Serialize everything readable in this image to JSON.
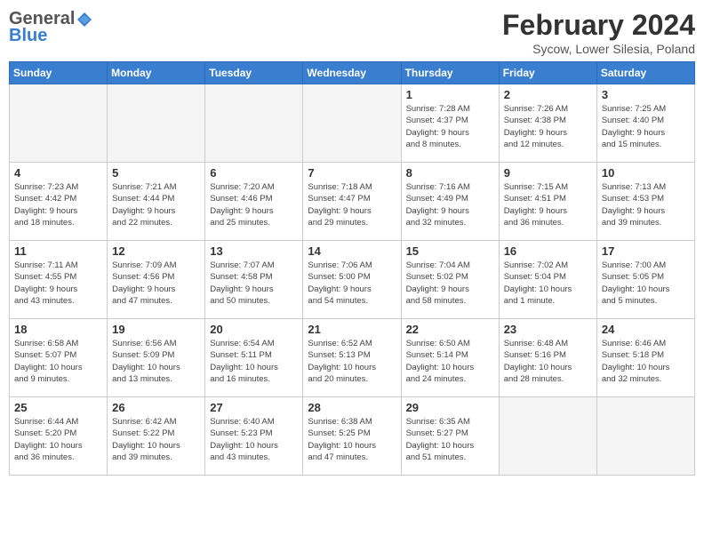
{
  "logo": {
    "general": "General",
    "blue": "Blue"
  },
  "header": {
    "title": "February 2024",
    "subtitle": "Sycow, Lower Silesia, Poland"
  },
  "weekdays": [
    "Sunday",
    "Monday",
    "Tuesday",
    "Wednesday",
    "Thursday",
    "Friday",
    "Saturday"
  ],
  "weeks": [
    [
      {
        "day": "",
        "detail": ""
      },
      {
        "day": "",
        "detail": ""
      },
      {
        "day": "",
        "detail": ""
      },
      {
        "day": "",
        "detail": ""
      },
      {
        "day": "1",
        "detail": "Sunrise: 7:28 AM\nSunset: 4:37 PM\nDaylight: 9 hours\nand 8 minutes."
      },
      {
        "day": "2",
        "detail": "Sunrise: 7:26 AM\nSunset: 4:38 PM\nDaylight: 9 hours\nand 12 minutes."
      },
      {
        "day": "3",
        "detail": "Sunrise: 7:25 AM\nSunset: 4:40 PM\nDaylight: 9 hours\nand 15 minutes."
      }
    ],
    [
      {
        "day": "4",
        "detail": "Sunrise: 7:23 AM\nSunset: 4:42 PM\nDaylight: 9 hours\nand 18 minutes."
      },
      {
        "day": "5",
        "detail": "Sunrise: 7:21 AM\nSunset: 4:44 PM\nDaylight: 9 hours\nand 22 minutes."
      },
      {
        "day": "6",
        "detail": "Sunrise: 7:20 AM\nSunset: 4:46 PM\nDaylight: 9 hours\nand 25 minutes."
      },
      {
        "day": "7",
        "detail": "Sunrise: 7:18 AM\nSunset: 4:47 PM\nDaylight: 9 hours\nand 29 minutes."
      },
      {
        "day": "8",
        "detail": "Sunrise: 7:16 AM\nSunset: 4:49 PM\nDaylight: 9 hours\nand 32 minutes."
      },
      {
        "day": "9",
        "detail": "Sunrise: 7:15 AM\nSunset: 4:51 PM\nDaylight: 9 hours\nand 36 minutes."
      },
      {
        "day": "10",
        "detail": "Sunrise: 7:13 AM\nSunset: 4:53 PM\nDaylight: 9 hours\nand 39 minutes."
      }
    ],
    [
      {
        "day": "11",
        "detail": "Sunrise: 7:11 AM\nSunset: 4:55 PM\nDaylight: 9 hours\nand 43 minutes."
      },
      {
        "day": "12",
        "detail": "Sunrise: 7:09 AM\nSunset: 4:56 PM\nDaylight: 9 hours\nand 47 minutes."
      },
      {
        "day": "13",
        "detail": "Sunrise: 7:07 AM\nSunset: 4:58 PM\nDaylight: 9 hours\nand 50 minutes."
      },
      {
        "day": "14",
        "detail": "Sunrise: 7:06 AM\nSunset: 5:00 PM\nDaylight: 9 hours\nand 54 minutes."
      },
      {
        "day": "15",
        "detail": "Sunrise: 7:04 AM\nSunset: 5:02 PM\nDaylight: 9 hours\nand 58 minutes."
      },
      {
        "day": "16",
        "detail": "Sunrise: 7:02 AM\nSunset: 5:04 PM\nDaylight: 10 hours\nand 1 minute."
      },
      {
        "day": "17",
        "detail": "Sunrise: 7:00 AM\nSunset: 5:05 PM\nDaylight: 10 hours\nand 5 minutes."
      }
    ],
    [
      {
        "day": "18",
        "detail": "Sunrise: 6:58 AM\nSunset: 5:07 PM\nDaylight: 10 hours\nand 9 minutes."
      },
      {
        "day": "19",
        "detail": "Sunrise: 6:56 AM\nSunset: 5:09 PM\nDaylight: 10 hours\nand 13 minutes."
      },
      {
        "day": "20",
        "detail": "Sunrise: 6:54 AM\nSunset: 5:11 PM\nDaylight: 10 hours\nand 16 minutes."
      },
      {
        "day": "21",
        "detail": "Sunrise: 6:52 AM\nSunset: 5:13 PM\nDaylight: 10 hours\nand 20 minutes."
      },
      {
        "day": "22",
        "detail": "Sunrise: 6:50 AM\nSunset: 5:14 PM\nDaylight: 10 hours\nand 24 minutes."
      },
      {
        "day": "23",
        "detail": "Sunrise: 6:48 AM\nSunset: 5:16 PM\nDaylight: 10 hours\nand 28 minutes."
      },
      {
        "day": "24",
        "detail": "Sunrise: 6:46 AM\nSunset: 5:18 PM\nDaylight: 10 hours\nand 32 minutes."
      }
    ],
    [
      {
        "day": "25",
        "detail": "Sunrise: 6:44 AM\nSunset: 5:20 PM\nDaylight: 10 hours\nand 36 minutes."
      },
      {
        "day": "26",
        "detail": "Sunrise: 6:42 AM\nSunset: 5:22 PM\nDaylight: 10 hours\nand 39 minutes."
      },
      {
        "day": "27",
        "detail": "Sunrise: 6:40 AM\nSunset: 5:23 PM\nDaylight: 10 hours\nand 43 minutes."
      },
      {
        "day": "28",
        "detail": "Sunrise: 6:38 AM\nSunset: 5:25 PM\nDaylight: 10 hours\nand 47 minutes."
      },
      {
        "day": "29",
        "detail": "Sunrise: 6:35 AM\nSunset: 5:27 PM\nDaylight: 10 hours\nand 51 minutes."
      },
      {
        "day": "",
        "detail": ""
      },
      {
        "day": "",
        "detail": ""
      }
    ]
  ]
}
